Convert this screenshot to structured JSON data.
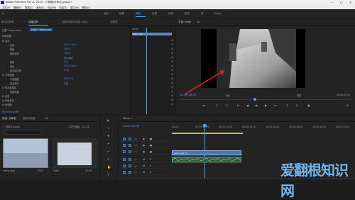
{
  "titlebar": {
    "title": "Adobe Premiere Pro CC 2015 - F:\\视频\\未命名.prproj *",
    "minimize": "—",
    "maximize": "☐",
    "close": "✕"
  },
  "menu": [
    "文件(F)",
    "编辑(E)",
    "剪辑(C)",
    "序列(S)",
    "标记(M)",
    "字幕(T)",
    "窗口(W)",
    "帮助(H)"
  ],
  "workspaces": [
    "组件",
    "编辑",
    "颜色",
    "效果",
    "音频",
    "图形",
    "库",
    "Editor"
  ],
  "workspace_active": 2,
  "effect_controls": {
    "tabs": [
      "源:(无剪辑)",
      "效果控件",
      "音频剪辑混合器: hehe",
      "元数据"
    ],
    "active_tab": 1,
    "source": "主要 * hehe.mp4",
    "source_seq": "hehe * hehe.mp4",
    "video_effects": "视频效果",
    "rows": [
      {
        "label": "fx 运动",
        "value": ""
      },
      {
        "label": "位置",
        "value": "372.0    140.0"
      },
      {
        "label": "缩放",
        "value": "100.0"
      },
      {
        "label": "缩放宽度",
        "value": "100.0"
      },
      {
        "label": "",
        "value": "等比缩放"
      },
      {
        "label": "旋转",
        "value": "0.0"
      },
      {
        "label": "锚点",
        "value": "372.0    140.0"
      },
      {
        "label": "防闪烁滤镜",
        "value": "0.00"
      },
      {
        "label": "fx 不透明度",
        "value": ""
      },
      {
        "label": "不透明度",
        "value": "100.0 %"
      },
      {
        "label": "混合模式",
        "value": "正常"
      },
      {
        "label": "fx 时间重映射",
        "value": ""
      },
      {
        "label": "音频效果",
        "value": ""
      },
      {
        "label": "fx 音量",
        "value": ""
      },
      {
        "label": "fx 声道音量",
        "value": ""
      },
      {
        "label": "fx 声像器",
        "value": ""
      }
    ],
    "mini_time": "00:00",
    "mini_clip": "hehe.mp4",
    "timecode": "00:00:16:00"
  },
  "program": {
    "title": "节目: hehe",
    "timecode": "00:00:16:00",
    "fit": "适合",
    "quality": "完整",
    "duration": "00:00:37:05"
  },
  "project": {
    "tabs": [
      "项目: 未命名",
      "媒体浏览器",
      "库"
    ],
    "path": "未命名.prproj",
    "count": "1 项已选择，共 2 项",
    "items": [
      {
        "name": "hehe.mp4",
        "duration": "37:05"
      },
      {
        "name": "hehe",
        "duration": "37:05"
      }
    ]
  },
  "timeline": {
    "tab": "hehe",
    "timecode": "00:00:16:00",
    "ruler": [
      "00:00",
      "00:00:05:00",
      "00:00:10:00",
      "00:00:15:00",
      "00:00:20:00",
      "00:00:25:00",
      "00:00:30:00",
      "00:00:35:00"
    ],
    "tracks": [
      "V3",
      "V2",
      "V1",
      "A1",
      "A2",
      "A3"
    ],
    "clip_video": "hehe.mp4 [V]"
  },
  "watermark": "爱翻根知识网",
  "accent": "#4d9ef0"
}
